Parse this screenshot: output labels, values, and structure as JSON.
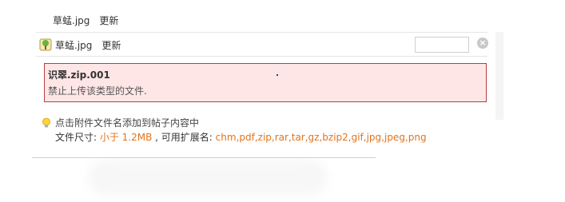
{
  "attachments": [
    {
      "filename": "草蜢.jpg",
      "action": "更新"
    },
    {
      "filename": "草蜢.jpg",
      "action": "更新"
    }
  ],
  "error": {
    "title": "识翠.zip.001",
    "message": "禁止上传该类型的文件."
  },
  "hint": {
    "text": "点击附件文件名添加到帖子内容中",
    "size_label": "文件尺寸: ",
    "size_value": "小于 1.2MB",
    "ext_label": " , 可用扩展名: ",
    "ext_value": "chm,pdf,zip,rar,tar,gz,bzip2,gif,jpg,jpeg,png"
  },
  "colors": {
    "error_bg": "#ffe6e6",
    "error_border": "#b0413e",
    "accent_orange": "#e3731a"
  },
  "icons": [
    "image-file-icon",
    "close-icon",
    "lightbulb-icon"
  ]
}
